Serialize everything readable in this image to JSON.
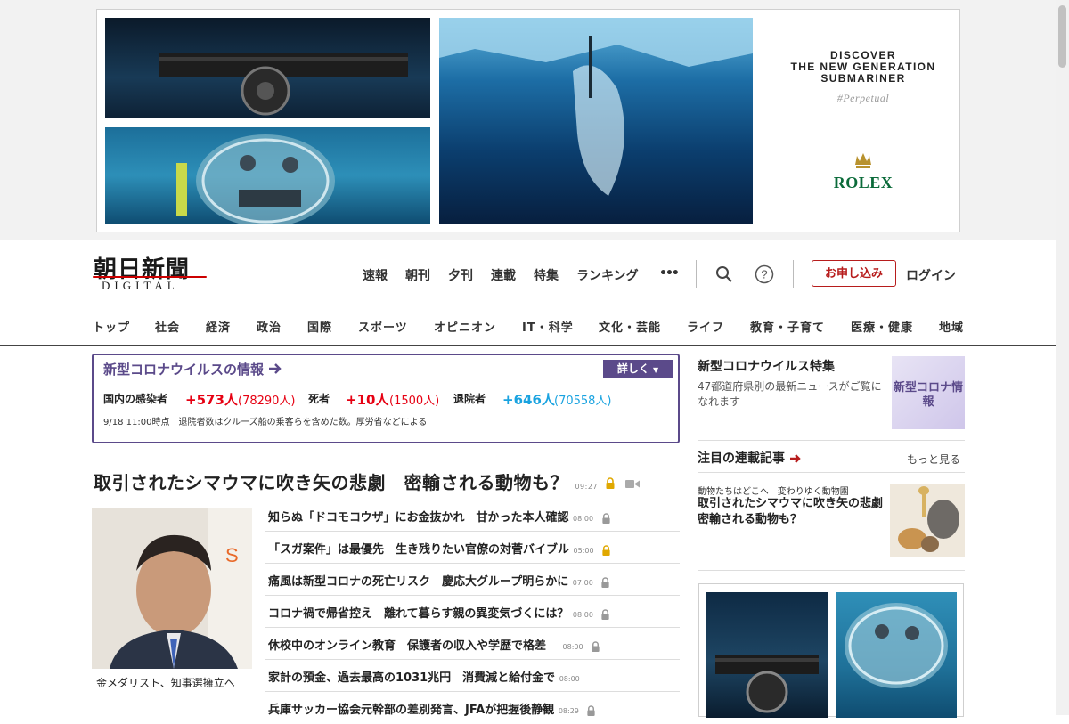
{
  "ad": {
    "copy_line1": "DISCOVER",
    "copy_line2": "THE NEW GENERATION",
    "copy_line3": "SUBMARINER",
    "tagline": "#Perpetual",
    "brand": "ROLEX"
  },
  "header": {
    "logo": "朝日新聞",
    "logo_sub": "DIGITAL",
    "nav": [
      "速報",
      "朝刊",
      "夕刊",
      "連載",
      "特集",
      "ランキング",
      "•••"
    ],
    "apply_label": "お申し込み",
    "login_label": "ログイン"
  },
  "categories": [
    "トップ",
    "社会",
    "経済",
    "政治",
    "国際",
    "スポーツ",
    "オピニオン",
    "IT・科学",
    "文化・芸能",
    "ライフ",
    "教育・子育て",
    "医療・健康",
    "地域"
  ],
  "corona": {
    "title": "新型コロナウイルスの情報",
    "detail_label": "詳しく",
    "domestic_label": "国内の感染者",
    "domestic_new": "+573人",
    "domestic_total": "(78290人)",
    "death_label": "死者",
    "death_new": "+10人",
    "death_total": "(1500人)",
    "recovered_label": "退院者",
    "recovered_new": "+646人",
    "recovered_total": "(70558人)",
    "note": "9/18 11:00時点　退院者数はクルーズ船の乗客らを含めた数。厚労省などによる",
    "colors": {
      "accent": "#5b4a8a",
      "increase": "#e60012",
      "recovered": "#1aa3e0"
    }
  },
  "main": {
    "headline": "取引されたシマウマに吹き矢の悲劇　密輸される動物も？",
    "headline_time": "09:27",
    "photo_caption": "金メダリスト、知事選擁立へ",
    "news": [
      {
        "title": "知らぬ「ドコモコウザ」にお金抜かれ　甘かった本人確認",
        "time": "08:00",
        "lock": "gray"
      },
      {
        "title": "「スガ案件」は最優先　生き残りたい官僚の対菅バイブル",
        "time": "05:00",
        "lock": "gold"
      },
      {
        "title": "痛風は新型コロナの死亡リスク　慶応大グループ明らかに",
        "time": "07:00",
        "lock": "gray"
      },
      {
        "title": "コロナ禍で帰省控え　離れて暮らす親の異変気づくには？",
        "time": "08:00",
        "lock": "gray"
      },
      {
        "title": "休校中のオンライン教育　保護者の収入や学歴で格差",
        "time": "08:00",
        "lock": "gray"
      },
      {
        "title": "家計の預金、過去最高の1031兆円　消費減と給付金で",
        "time": "08:00",
        "lock": "none"
      },
      {
        "title": "兵庫サッカー協会元幹部の差別発言、JFAが把握後静観",
        "time": "08:29",
        "lock": "gray"
      }
    ]
  },
  "sidebar": {
    "covid_feature_title": "新型コロナウイルス特集",
    "covid_feature_text": "47都道府県別の最新ニュースがご覧になれます",
    "covid_thumb_label": "新型コロナ情報",
    "series_title": "注目の連載記事",
    "more_label": "もっと見る",
    "series_kicker": "動物たちはどこへ　変わりゆく動物園",
    "series_text": "取引されたシマウマに吹き矢の悲劇　密輸される動物も？"
  }
}
